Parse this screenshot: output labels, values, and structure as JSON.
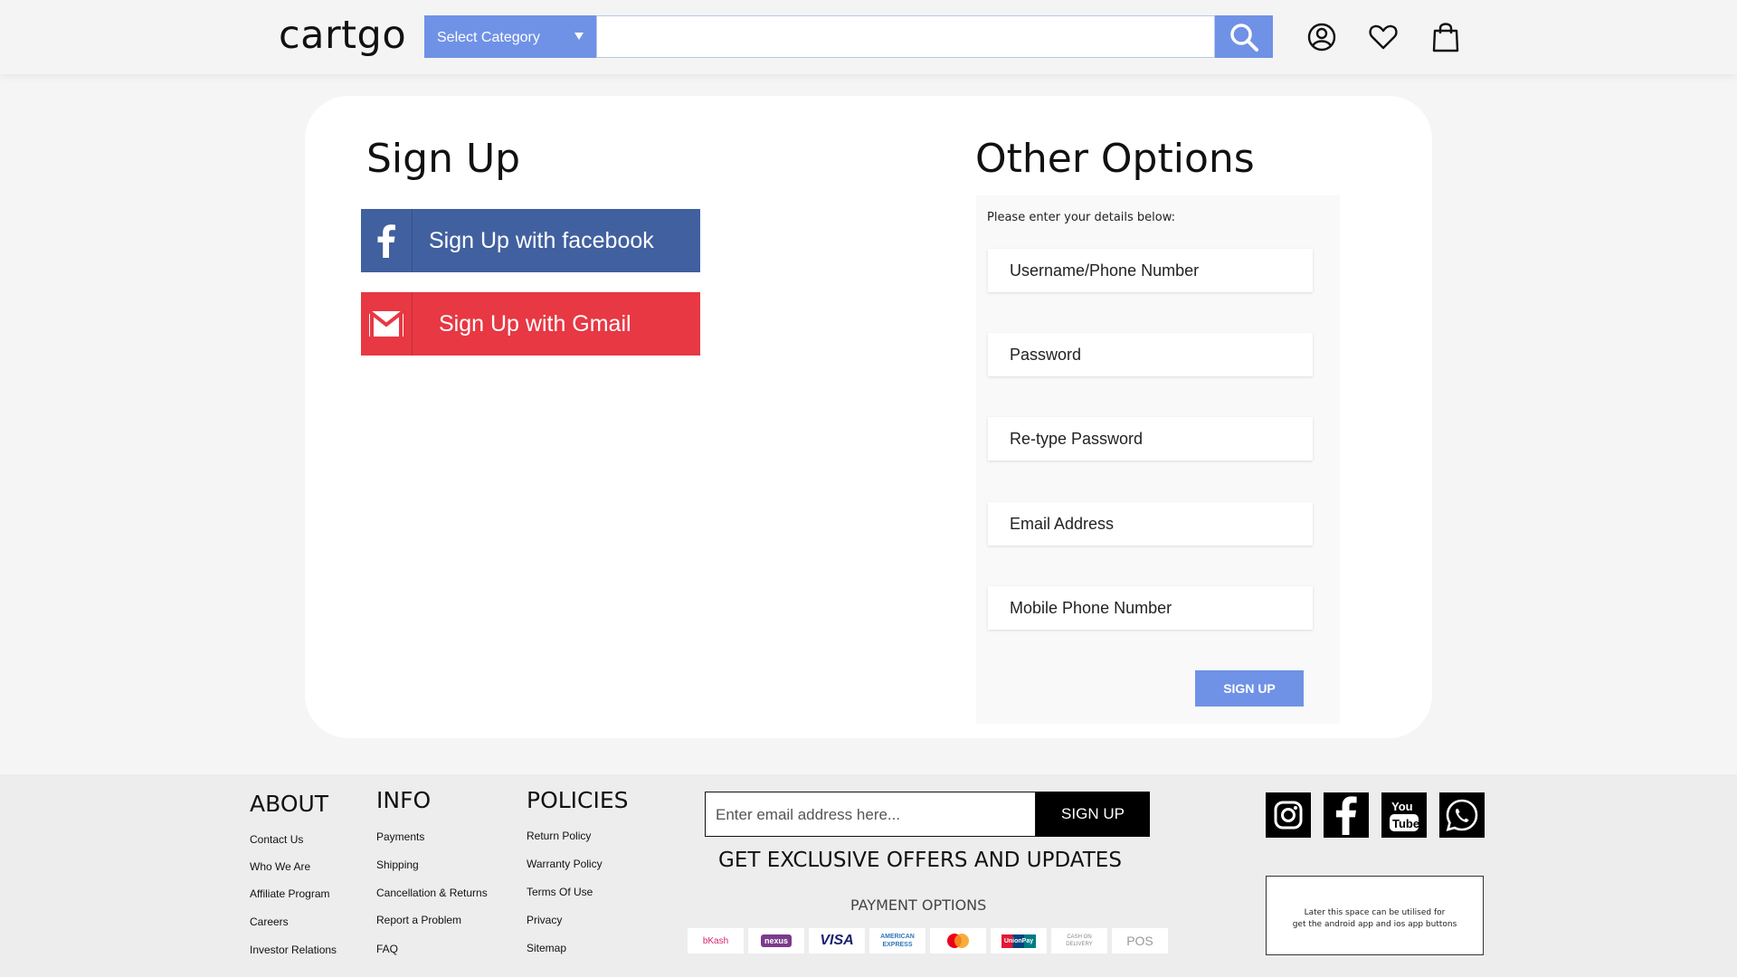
{
  "header": {
    "logo": "cartgo",
    "category_select": "Select Category",
    "search_placeholder": ""
  },
  "signup": {
    "title": "Sign Up",
    "facebook_label": "Sign Up with facebook",
    "gmail_label": "Sign Up with Gmail"
  },
  "other": {
    "title": "Other Options",
    "hint": "Please enter your details below:",
    "fields": [
      "Username/Phone Number",
      "Password",
      "Re-type Password",
      "Email Address",
      "Mobile Phone Number"
    ],
    "submit_label": "SIGN UP"
  },
  "footer": {
    "about": {
      "title": "ABOUT",
      "links": [
        "Contact Us",
        "Who We Are",
        "Affiliate Program",
        "Careers",
        "Investor Relations"
      ]
    },
    "info": {
      "title": "INFO",
      "links": [
        "Payments",
        "Shipping",
        "Cancellation & Returns",
        "Report a Problem",
        "FAQ"
      ]
    },
    "policies": {
      "title": "POLICIES",
      "links": [
        "Return Policy",
        "Warranty Policy",
        "Terms Of Use",
        "Privacy",
        "Sitemap"
      ]
    },
    "newsletter": {
      "placeholder": "Enter email address here...",
      "button_label": "SIGN UP",
      "offers_text": "GET EXCLUSIVE OFFERS AND UPDATES"
    },
    "payment": {
      "title": "PAYMENT OPTIONS",
      "methods": [
        "bKash",
        "nexus",
        "VISA",
        "AMERICAN EXPRESS",
        "mastercard",
        "UnionPay",
        "CASH ON DELIVERY",
        "POS"
      ]
    },
    "social_icons": [
      "instagram-icon",
      "facebook-icon",
      "youtube-icon",
      "whatsapp-icon"
    ],
    "app_box_line1": "Later this space can be utilised for",
    "app_box_line2": "get the android app and ios app  buttons"
  },
  "colors": {
    "accent": "#6f92e6",
    "facebook": "#41609f",
    "gmail": "#e73843"
  }
}
